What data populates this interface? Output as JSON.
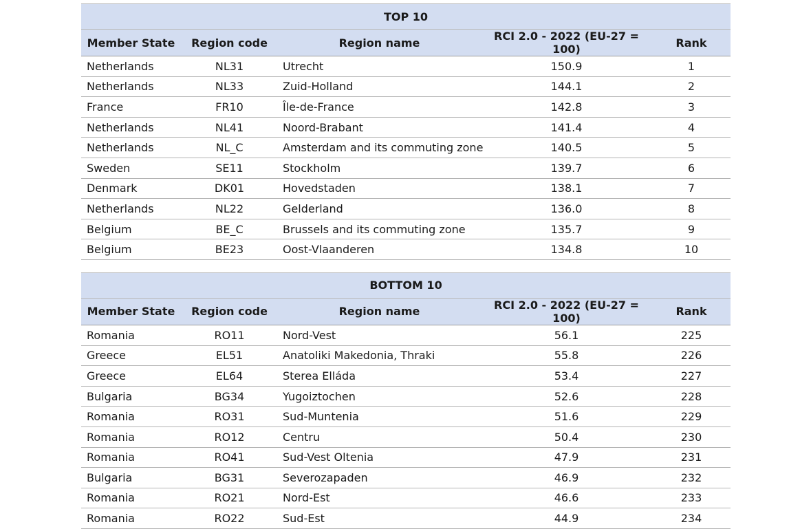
{
  "headers": {
    "member_state": "Member State",
    "region_code": "Region code",
    "region_name": "Region name",
    "rci": "RCI 2.0 - 2022 (EU-27 = 100)",
    "rank": "Rank"
  },
  "top": {
    "title": "TOP 10",
    "rows": [
      {
        "ms": "Netherlands",
        "code": "NL31",
        "name": "Utrecht",
        "rci": "150.9",
        "rank": "1"
      },
      {
        "ms": "Netherlands",
        "code": "NL33",
        "name": "Zuid-Holland",
        "rci": "144.1",
        "rank": "2"
      },
      {
        "ms": "France",
        "code": "FR10",
        "name": "Île-de-France",
        "rci": "142.8",
        "rank": "3"
      },
      {
        "ms": "Netherlands",
        "code": "NL41",
        "name": "Noord-Brabant",
        "rci": "141.4",
        "rank": "4"
      },
      {
        "ms": "Netherlands",
        "code": "NL_C",
        "name": "Amsterdam and its commuting zone",
        "rci": "140.5",
        "rank": "5"
      },
      {
        "ms": "Sweden",
        "code": "SE11",
        "name": "Stockholm",
        "rci": "139.7",
        "rank": "6"
      },
      {
        "ms": "Denmark",
        "code": "DK01",
        "name": "Hovedstaden",
        "rci": "138.1",
        "rank": "7"
      },
      {
        "ms": "Netherlands",
        "code": "NL22",
        "name": "Gelderland",
        "rci": "136.0",
        "rank": "8"
      },
      {
        "ms": "Belgium",
        "code": "BE_C",
        "name": "Brussels and its commuting zone",
        "rci": "135.7",
        "rank": "9"
      },
      {
        "ms": "Belgium",
        "code": "BE23",
        "name": "Oost-Vlaanderen",
        "rci": "134.8",
        "rank": "10"
      }
    ]
  },
  "bottom": {
    "title": "BOTTOM 10",
    "rows": [
      {
        "ms": "Romania",
        "code": "RO11",
        "name": "Nord-Vest",
        "rci": "56.1",
        "rank": "225"
      },
      {
        "ms": "Greece",
        "code": "EL51",
        "name": "Anatoliki Makedonia, Thraki",
        "rci": "55.8",
        "rank": "226"
      },
      {
        "ms": "Greece",
        "code": "EL64",
        "name": "Sterea Elláda",
        "rci": "53.4",
        "rank": "227"
      },
      {
        "ms": "Bulgaria",
        "code": "BG34",
        "name": "Yugoiztochen",
        "rci": "52.6",
        "rank": "228"
      },
      {
        "ms": "Romania",
        "code": "RO31",
        "name": "Sud-Muntenia",
        "rci": "51.6",
        "rank": "229"
      },
      {
        "ms": "Romania",
        "code": "RO12",
        "name": "Centru",
        "rci": "50.4",
        "rank": "230"
      },
      {
        "ms": "Romania",
        "code": "RO41",
        "name": "Sud-Vest Oltenia",
        "rci": "47.9",
        "rank": "231"
      },
      {
        "ms": "Bulgaria",
        "code": "BG31",
        "name": "Severozapaden",
        "rci": "46.9",
        "rank": "232"
      },
      {
        "ms": "Romania",
        "code": "RO21",
        "name": "Nord-Est",
        "rci": "46.6",
        "rank": "233"
      },
      {
        "ms": "Romania",
        "code": "RO22",
        "name": "Sud-Est",
        "rci": "44.9",
        "rank": "234"
      }
    ]
  }
}
